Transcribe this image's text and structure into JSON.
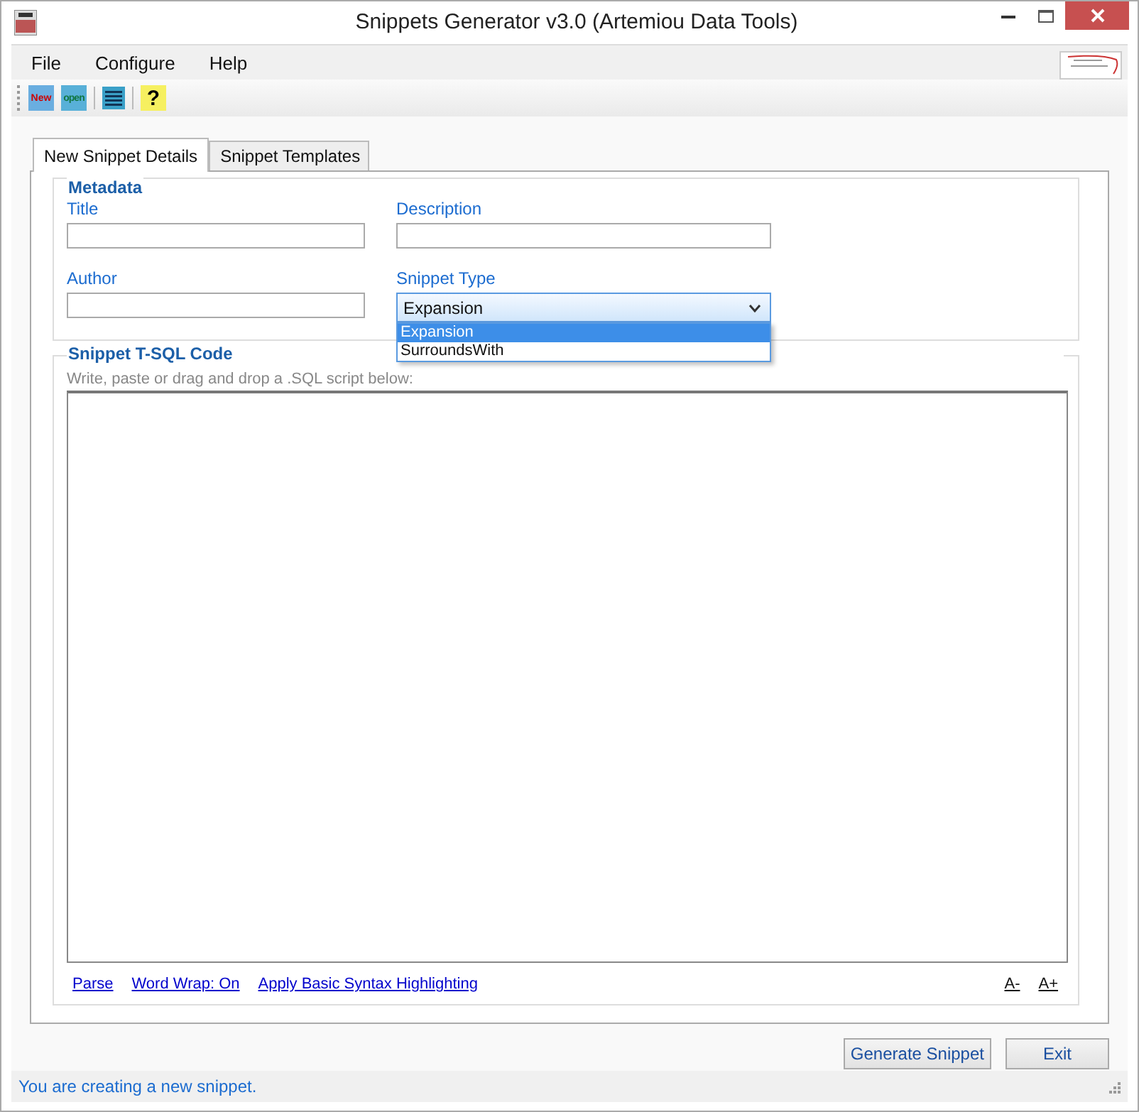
{
  "window": {
    "title": "Snippets Generator v3.0 (Artemiou Data Tools)"
  },
  "menu": [
    "File",
    "Configure",
    "Help"
  ],
  "toolbar": [
    {
      "kind": "new",
      "label": "New"
    },
    {
      "kind": "open",
      "label": "open"
    },
    {
      "kind": "sep"
    },
    {
      "kind": "list"
    },
    {
      "kind": "sep"
    },
    {
      "kind": "help",
      "label": "?"
    }
  ],
  "tabs": [
    {
      "label": "New Snippet Details",
      "selected": true
    },
    {
      "label": "Snippet Templates",
      "selected": false
    }
  ],
  "metadata": {
    "title": "Metadata",
    "fields": [
      {
        "label": "Title",
        "kind": "text"
      },
      {
        "label": "Description",
        "kind": "text"
      },
      {
        "label": "Author",
        "kind": "text"
      },
      {
        "label": "Snippet Type",
        "kind": "select",
        "value": "Expansion",
        "expanded": true,
        "options": [
          {
            "label": "Expansion",
            "selected": true
          },
          {
            "label": "SurroundsWith",
            "selected": false
          }
        ]
      }
    ]
  },
  "code": {
    "title": "Snippet T-SQL Code",
    "hint": "Write, paste or drag and drop a .SQL script below:",
    "links": [
      "Parse",
      "Word Wrap: On",
      "Apply Basic Syntax Highlighting"
    ],
    "font_links": [
      "A-",
      "A+"
    ]
  },
  "buttons": [
    "Generate Snippet",
    "Exit"
  ],
  "status_bar": "You are creating a new snippet."
}
